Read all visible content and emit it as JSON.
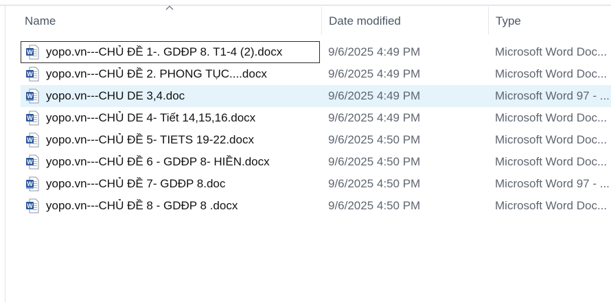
{
  "columns": {
    "name": "Name",
    "date": "Date modified",
    "type": "Type"
  },
  "files": [
    {
      "name": "yopo.vn---CHỦ ĐỀ 1-. GDĐP 8. T1-4 (2).docx",
      "date": "9/6/2025 4:49 PM",
      "type": "Microsoft Word Doc...",
      "icon": "word-docx-icon"
    },
    {
      "name": "yopo.vn---CHỦ ĐỀ 2. PHONG TỤC....docx",
      "date": "9/6/2025 4:49 PM",
      "type": "Microsoft Word Doc...",
      "icon": "word-docx-icon"
    },
    {
      "name": "yopo.vn---CHU DE 3,4.doc",
      "date": "9/6/2025 4:49 PM",
      "type": "Microsoft Word 97 - ...",
      "icon": "word-doc-icon"
    },
    {
      "name": "yopo.vn---CHỦ DE 4- Tiết 14,15,16.docx",
      "date": "9/6/2025 4:49 PM",
      "type": "Microsoft Word Doc...",
      "icon": "word-docx-icon"
    },
    {
      "name": "yopo.vn---CHỦ ĐỀ 5- TIETS 19-22.docx",
      "date": "9/6/2025 4:50 PM",
      "type": "Microsoft Word Doc...",
      "icon": "word-docx-icon"
    },
    {
      "name": "yopo.vn---CHỦ ĐỀ 6 - GDĐP 8- HIỀN.docx",
      "date": "9/6/2025 4:50 PM",
      "type": "Microsoft Word Doc...",
      "icon": "word-docx-icon"
    },
    {
      "name": "yopo.vn---CHỦ ĐỀ 7- GDĐP 8.doc",
      "date": "9/6/2025 4:50 PM",
      "type": "Microsoft Word 97 - ...",
      "icon": "word-doc-icon"
    },
    {
      "name": "yopo.vn---CHỦ ĐỀ 8 - GDĐP 8 .docx",
      "date": "9/6/2025 4:50 PM",
      "type": "Microsoft Word Doc...",
      "icon": "word-docx-icon"
    }
  ],
  "state": {
    "focused_row": 0,
    "selected_row": 2,
    "sort_column": "Name",
    "sort_direction": "ascending"
  },
  "colors": {
    "selection": "#e5f3fb",
    "word_blue": "#2b579a"
  }
}
